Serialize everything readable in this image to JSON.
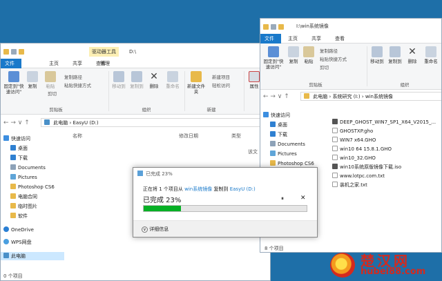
{
  "left": {
    "title": "D:\\",
    "contextual_tab": "驱动器工具",
    "tabs": [
      "文件",
      "主页",
      "共享",
      "查看",
      "管理"
    ],
    "ribbon": {
      "pin": "固定到\"快速访问\"",
      "copy": "复制",
      "paste": "粘贴",
      "copy_path": "复制路径",
      "paste_shortcut": "粘贴快捷方式",
      "cut": "剪切",
      "clipboard": "剪贴板",
      "move_to": "移动到",
      "copy_to": "复制到",
      "delete": "删除",
      "rename": "重命名",
      "organize": "组织",
      "new_folder": "新建文件夹",
      "new_item": "新建项目",
      "easy_access": "轻松访问",
      "new": "新建",
      "properties": "属性"
    },
    "address": [
      "此电脑",
      "EasyU (D:)"
    ],
    "columns": [
      "名称",
      "修改日期",
      "类型"
    ],
    "status_text": "该文",
    "nav": [
      {
        "icon": "star",
        "label": "快速访问"
      },
      {
        "icon": "desktop",
        "label": "桌面"
      },
      {
        "icon": "download",
        "label": "下载"
      },
      {
        "icon": "doc",
        "label": "Documents"
      },
      {
        "icon": "pic",
        "label": "Pictures"
      },
      {
        "icon": "folder",
        "label": "Photoshop CS6"
      },
      {
        "icon": "folder",
        "label": "电脑合同"
      },
      {
        "icon": "folder",
        "label": "临时图片"
      },
      {
        "icon": "folder",
        "label": "软件"
      },
      {
        "icon": "cloud",
        "label": "OneDrive"
      },
      {
        "icon": "wps",
        "label": "WPS网盘"
      },
      {
        "icon": "pc",
        "label": "此电脑"
      }
    ],
    "status_count": "0 个项目"
  },
  "right": {
    "title": "I:\\win系统镜像",
    "tabs": [
      "文件",
      "主页",
      "共享",
      "查看"
    ],
    "ribbon": {
      "pin": "固定到\"快速访问\"",
      "copy": "复制",
      "paste": "粘贴",
      "copy_path": "复制路径",
      "paste_shortcut": "粘贴快捷方式",
      "cut": "剪切",
      "clipboard": "剪贴板",
      "move_to": "移动到",
      "copy_to": "复制到",
      "delete": "删除",
      "rename": "重命名",
      "organize": "组织"
    },
    "address": [
      "此电脑",
      "系统研究 (I:)",
      "win系统镜像"
    ],
    "nav": [
      {
        "label": "快速访问"
      },
      {
        "label": "桌面"
      },
      {
        "label": "下载"
      },
      {
        "label": "Documents"
      },
      {
        "label": "Pictures"
      },
      {
        "label": "Photoshop CS6"
      }
    ],
    "files": [
      {
        "name": "DEEP_GHOST_WIN7_SP1_X64_V2015_...",
        "icon": "iso"
      },
      {
        "name": "GHOSTXP.gho",
        "icon": "gho"
      },
      {
        "name": "WIN7 x64.GHO",
        "icon": "gho"
      },
      {
        "name": "win10 64 15.8.1.GHO",
        "icon": "gho"
      },
      {
        "name": "win10_32.GHO",
        "icon": "gho"
      },
      {
        "name": "win10系统原版镜像下载.iso",
        "icon": "iso"
      },
      {
        "name": "www.lotpc.com.txt",
        "icon": "txt"
      },
      {
        "name": "装机之家.txt",
        "icon": "txt"
      }
    ],
    "status_count": "8 个项目"
  },
  "dialog": {
    "title": "已完成 23%",
    "line1_prefix": "正在将 1 个项目从 ",
    "source": "win系统镜像",
    "line1_mid": " 复制到 ",
    "target": "EasyU (D:)",
    "progress_text": "已完成 23%",
    "progress": 0.23,
    "details": "详细信息"
  },
  "watermark": {
    "site": "楚汉网",
    "url": "hubei88.com"
  },
  "colors": {
    "accent": "#1979ca",
    "progress_fill": "#06b025",
    "watermark_red": "#d42a1e"
  }
}
